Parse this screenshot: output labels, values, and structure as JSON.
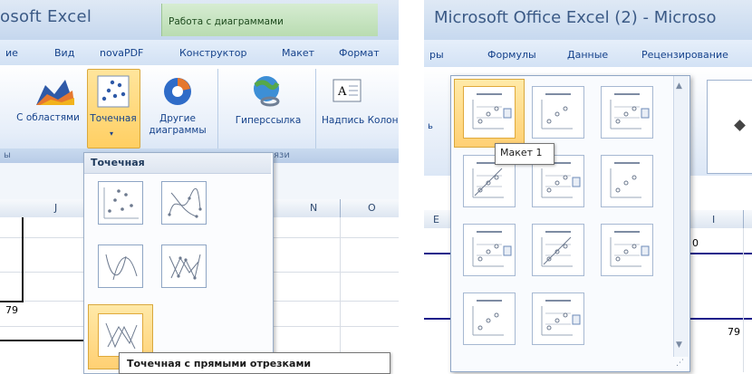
{
  "left": {
    "title_fragment": "osoft Excel",
    "context_tab": "Работа с диаграммами",
    "tabs": [
      "ие",
      "Вид",
      "novaPDF",
      "Конструктор",
      "Макет",
      "Формат"
    ],
    "ribbon_buttons": {
      "area_label": "С областями",
      "scatter_label": "Точечная",
      "other_label": "Другие диаграммы",
      "hyperlink_label": "Гиперссылка",
      "textbox_label": "Надпись",
      "col_label": "Колон"
    },
    "group_labels": [
      "ы",
      "язи"
    ],
    "columns": [
      "J",
      "N",
      "O"
    ],
    "cell_value": "79",
    "dropdown_header": "Точечная",
    "tooltip": "Точечная с прямыми отрезками"
  },
  "right": {
    "title": "Microsoft Office Excel (2) - Microso",
    "tabs": [
      "ры",
      "Формулы",
      "Данные",
      "Рецензирование"
    ],
    "ribbon_left_fragment": "ь",
    "columns": [
      "E",
      "I"
    ],
    "cell_value_top": "0",
    "cell_value": "79",
    "layout_tooltip": "Макет 1",
    "layout_count": 11
  },
  "colors": {
    "ribbon_blue": "#dfe9f5",
    "context_green": "#b9dcb1",
    "selection_orange": "#ffd073",
    "chart_line": "#1b1b8a"
  }
}
